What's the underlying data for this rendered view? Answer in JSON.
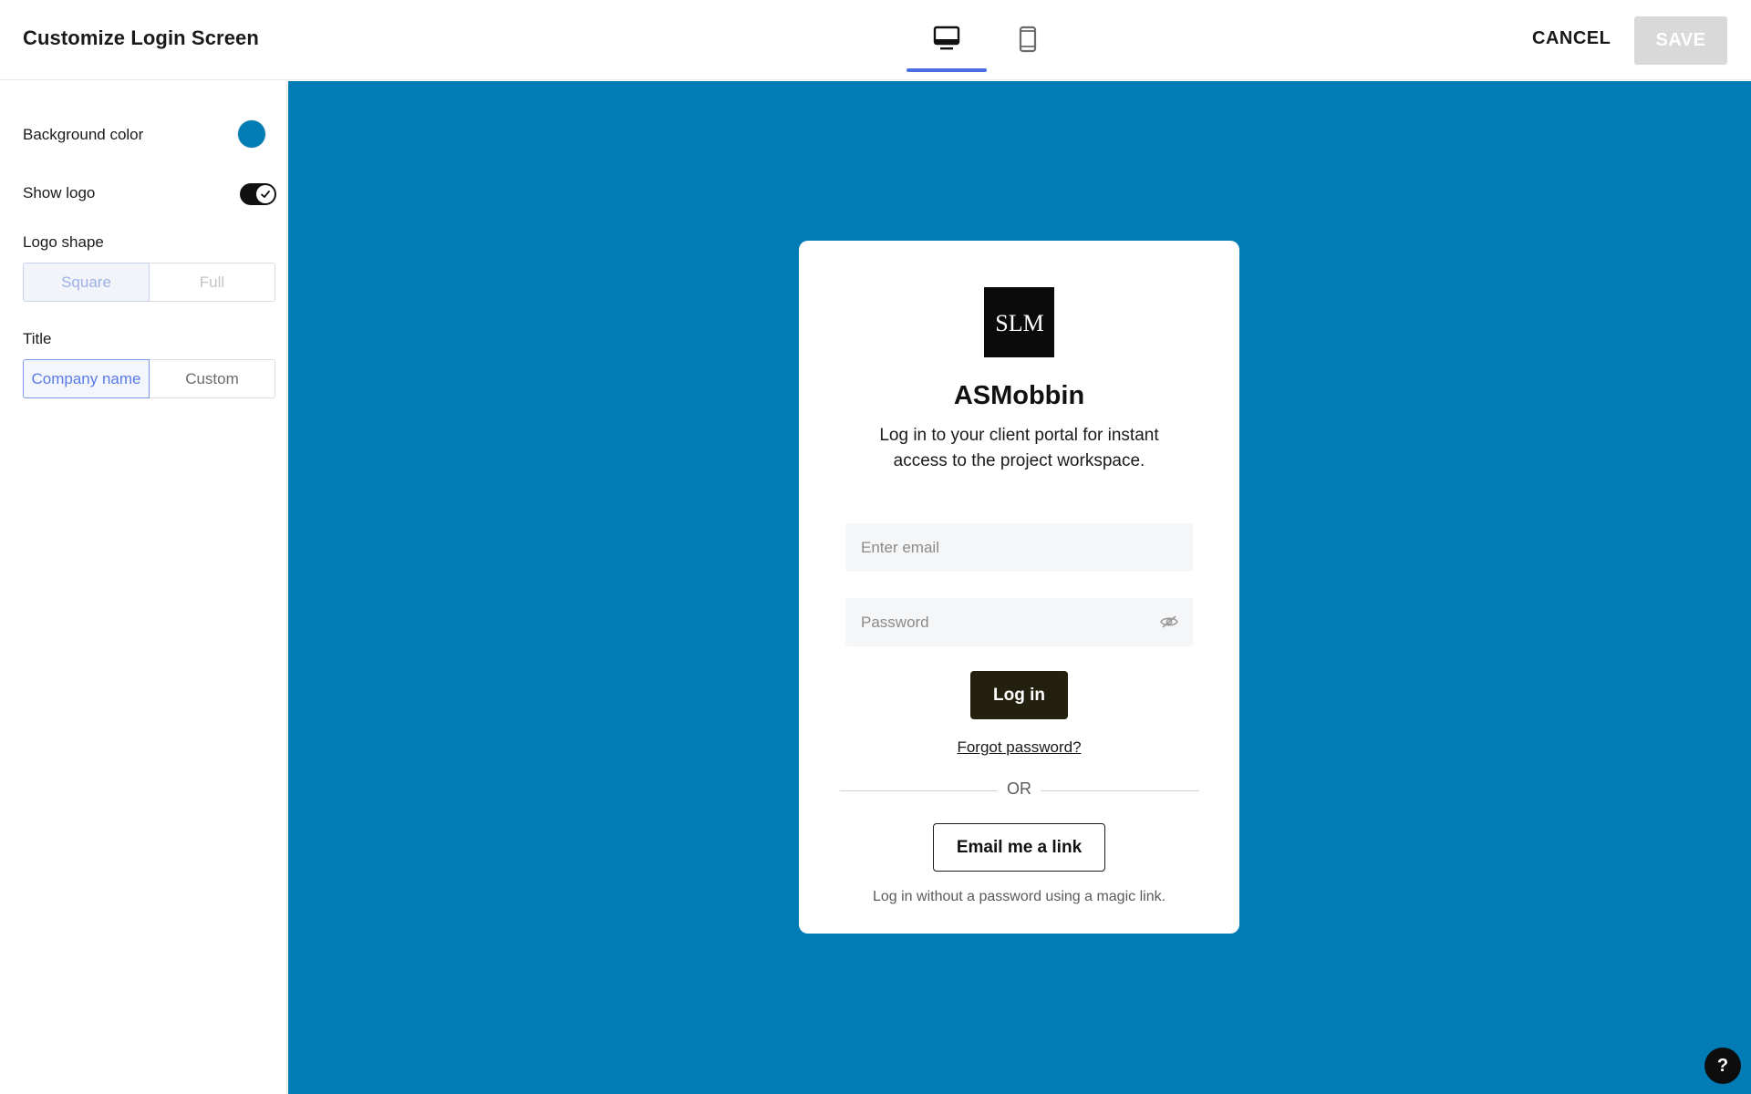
{
  "header": {
    "title": "Customize Login Screen",
    "tabs": [
      {
        "icon": "desktop-icon",
        "active": true
      },
      {
        "icon": "mobile-icon",
        "active": false
      }
    ],
    "cancel_label": "CANCEL",
    "save_label": "SAVE"
  },
  "sidebar": {
    "background_color_label": "Background color",
    "background_color_value": "#027cb4",
    "show_logo_label": "Show logo",
    "show_logo_enabled": true,
    "logo_shape_label": "Logo shape",
    "logo_shape_options": [
      "Square",
      "Full"
    ],
    "logo_shape_selected": "Square",
    "title_label": "Title",
    "title_options": [
      "Company name",
      "Custom"
    ],
    "title_selected": "Company name"
  },
  "preview": {
    "background_color": "#027cb4",
    "logo_text": "SLM",
    "company_name": "ASMobbin",
    "tagline": "Log in to your client portal for instant access to the project workspace.",
    "email_placeholder": "Enter email",
    "password_placeholder": "Password",
    "login_label": "Log in",
    "forgot_label": "Forgot password?",
    "or_label": "OR",
    "magic_link_label": "Email me a link",
    "magic_link_note": "Log in without a password using a magic link."
  },
  "help_label": "?",
  "colors": {
    "accent": "#4a6fe3",
    "brand_bg": "#027cb4",
    "login_button": "#23200f"
  }
}
